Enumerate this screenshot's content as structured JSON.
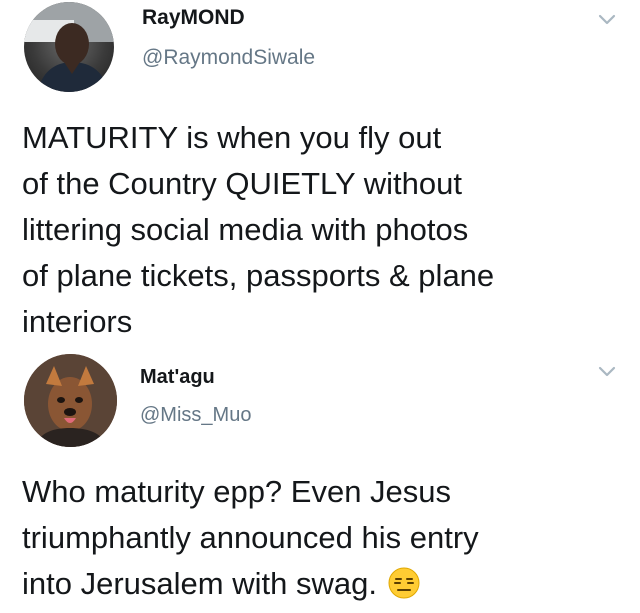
{
  "tweets": [
    {
      "display_name": "RayMOND",
      "handle": "@RaymondSiwale",
      "text": "MATURITY is when you fly out\nof the Country QUIETLY without\nlittering social media with photos\nof plane tickets, passports & plane\ninteriors",
      "avatar_icon": "profile-photo-man",
      "menu_icon": "chevron-down-icon"
    },
    {
      "display_name": "Mat'agu",
      "handle": "@Miss_Muo",
      "text": "Who maturity epp? Even Jesus\ntriumphantly announced his entry\ninto Jerusalem with swag.",
      "emoji": "expressionless-face-emoji",
      "avatar_icon": "profile-photo-woman-dog-filter",
      "menu_icon": "chevron-down-icon"
    }
  ],
  "colors": {
    "text": "#14171a",
    "handle": "#657786",
    "caret": "#aab8c2",
    "emoji": "#ffcc33"
  }
}
